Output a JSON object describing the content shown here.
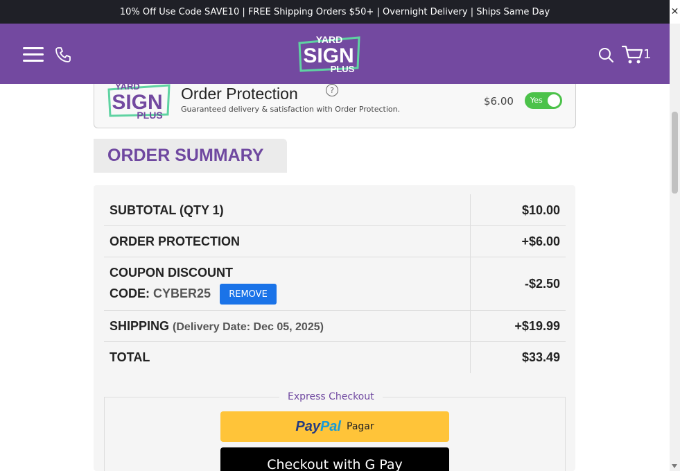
{
  "announcement": "10% Off Use Code SAVE10 | FREE Shipping Orders $50+ | Overnight Delivery | Ships Same Day",
  "header": {
    "logo_top": "YARD",
    "logo_middle": "SIGN",
    "logo_bottom": "PLUS",
    "cart_count": "1",
    "icons": [
      "menu-icon",
      "phone-icon",
      "search-icon",
      "cart-icon"
    ]
  },
  "protection": {
    "logo_top": "YARD",
    "logo_middle": "SIGN",
    "logo_bottom": "PLUS",
    "title": "Order Protection",
    "help": "?",
    "subtitle": "Guaranteed delivery & satisfaction with Order Protection.",
    "price": "$6.00",
    "toggle_label": "Yes",
    "enabled": true
  },
  "summary": {
    "heading": "ORDER SUMMARY",
    "rows": [
      {
        "label": "SUBTOTAL (QTY 1)",
        "value": "$10.00"
      },
      {
        "label": "ORDER PROTECTION",
        "value": "+$6.00"
      },
      {
        "label": "COUPON DISCOUNT",
        "code_label": "CODE:",
        "code": "CYBER25",
        "remove_label": "REMOVE",
        "value": "-$2.50"
      },
      {
        "label": "SHIPPING",
        "detail": "(Delivery Date: Dec 05, 2025)",
        "value": "+$19.99"
      },
      {
        "label": "TOTAL",
        "value": "$33.49"
      }
    ]
  },
  "express": {
    "legend": "Express Checkout",
    "paypal_pay": "Pay",
    "paypal_pal": "Pal",
    "paypal_sub": "Pagar",
    "gpay_label": "Checkout with G Pay"
  },
  "colors": {
    "header": "#7349a0",
    "accent": "#6f48a0",
    "toggle_on": "#4cc24a",
    "remove_button": "#1a73e8",
    "paypal": "#ffc439"
  }
}
